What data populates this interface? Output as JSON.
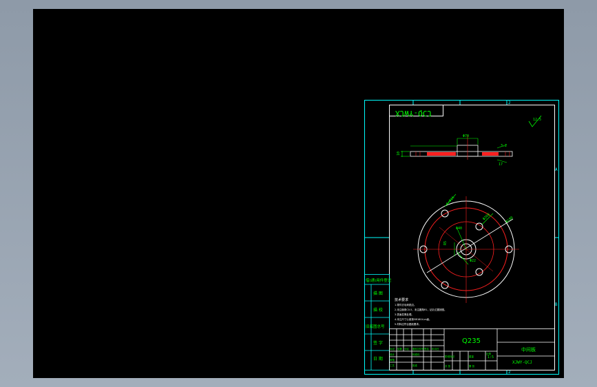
{
  "drawing": {
    "code_mirrored": "XJWY-QCJ",
    "material": "Q235",
    "part_name": "中间板",
    "drawing_code": "XJWY-QCJ",
    "scale": "1:5",
    "grid_numbers": [
      "4",
      "3",
      "2",
      "1"
    ],
    "grid_letters": [
      "A",
      "B"
    ],
    "roughness": "12.5",
    "dims": {
      "hub_dia": "Φ70",
      "thickness": "10",
      "chamfer": "3.2",
      "right_h": "17",
      "pcd": "Φ180",
      "hole": "6×Φ16",
      "bore": "Φ40",
      "od": "Φ260",
      "left_small": "R5",
      "center_small": "Φ22"
    },
    "notes_title": "技术要求",
    "notes": [
      "1.零件去毛刺锐边。",
      "2.未注倒角C0.5，未注圆角R1，钻孔位置按图。",
      "3.表面发黑处理。",
      "4.未注尺寸公差按GB1804-m级。",
      "5.材料应符合图纸要求。"
    ],
    "side_labels": [
      "借(通)用件登记",
      "描 图",
      "描 校",
      "旧底图总号",
      "签 字",
      "日 期"
    ],
    "title_cells": {
      "c1": "标记",
      "c2": "处数",
      "c3": "分区",
      "c4": "更改文件号",
      "c5": "签名",
      "c6": "年月日",
      "c7": "设计",
      "c8": "标准化",
      "c9": "阶段标记",
      "c10": "重量",
      "c11": "比例",
      "c12": "审核",
      "c13": "工艺",
      "c14": "批准",
      "c15": "共 张",
      "c16": "第 张"
    }
  }
}
